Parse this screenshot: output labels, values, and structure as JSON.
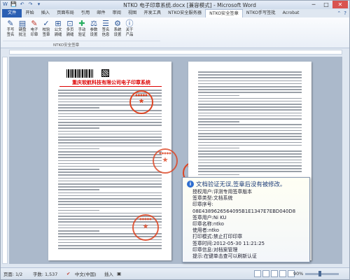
{
  "window": {
    "title": "NTKO 电子印章系统.docx [兼容模式] - Microsoft Word",
    "qat": [
      "W",
      "💾",
      "↶",
      "↷",
      "▾"
    ],
    "controls": [
      "─",
      "□",
      "✕"
    ]
  },
  "tabs": [
    "文件",
    "开始",
    "插入",
    "页面布局",
    "引用",
    "邮件",
    "审阅",
    "视图",
    "开发工具",
    "NTKO安全服务器",
    "NTKO安全签章",
    "NTKO手写签批",
    "Acrobat"
  ],
  "active_tab_index": 10,
  "tabs_right": [
    "⌃",
    "?"
  ],
  "ribbon": {
    "buttons": [
      {
        "icon": "✎",
        "color": "#2b579a",
        "label1": "手写",
        "label2": "签名"
      },
      {
        "icon": "▤",
        "color": "#2b579a",
        "label1": "键盘",
        "label2": "批注"
      },
      {
        "icon": "✎",
        "color": "#c0392b",
        "label1": "电子",
        "label2": "印章"
      },
      {
        "icon": "✓",
        "color": "#2b579a",
        "label1": "校验",
        "label2": "签章"
      },
      {
        "icon": "⊞",
        "color": "#2b579a",
        "label1": "公文",
        "label2": "骑缝"
      },
      {
        "icon": "⊡",
        "color": "#2b579a",
        "label1": "多页",
        "label2": "骑缝"
      },
      {
        "icon": "✚",
        "color": "#27ae60",
        "label1": "手动",
        "label2": "验证"
      },
      {
        "icon": "⚖",
        "color": "#2b579a",
        "label1": "参数",
        "label2": "设置"
      },
      {
        "icon": "☰",
        "color": "#2b579a",
        "label1": "签名",
        "label2": "信息"
      },
      {
        "icon": "⚙",
        "color": "#2b579a",
        "label1": "系统",
        "label2": "设置"
      },
      {
        "icon": "ⓘ",
        "color": "#2b579a",
        "label1": "关于",
        "label2": "产品"
      }
    ],
    "group_label": "NTKO安全签章"
  },
  "document": {
    "company_name": "重庆软航科技有限公司电子印章系统"
  },
  "tooltip": {
    "heading": "文档验证无误,签章后没有被修改。",
    "rows": [
      "授权用户:评测专用签章版本",
      "签章类型:文档系统",
      "印章序号:",
      "08E4389626564095B1E1347E7EBD040D8",
      "签章用户:Ni KU",
      "印章名称:ntko",
      "使用者:ntko",
      "打印模式:禁止打印印章",
      "签章时间:2012-05-30 11:21:25",
      "印章信息:对档案管理",
      "提示:在键单击查可以刷新认证"
    ]
  },
  "statusbar": {
    "page": "页面: 1/2",
    "words": "字数: 1,537",
    "lang": "中文(中国)",
    "mode": "插入",
    "zoom": "90%"
  }
}
